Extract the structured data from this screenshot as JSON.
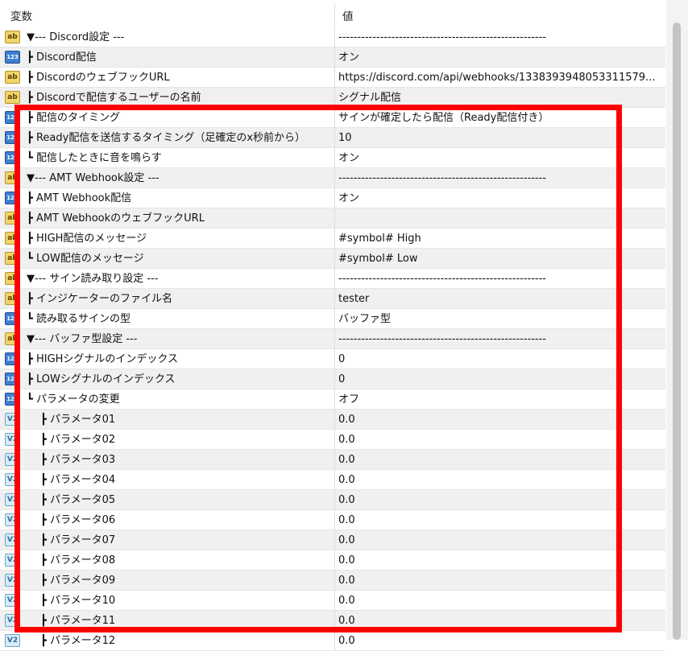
{
  "header": {
    "col_name": "変数",
    "col_value": "値"
  },
  "rows": [
    {
      "name": "▼--- Discord設定 ---",
      "value": "-------------------------------------------------------",
      "icon": "ab",
      "indent": 0
    },
    {
      "name": "┣ Discord配信",
      "value": "オン",
      "icon": "123",
      "indent": 0
    },
    {
      "name": "┣ DiscordのウェブフックURL",
      "value": "https://discord.com/api/webhooks/1338393948053311579...",
      "icon": "ab",
      "indent": 0
    },
    {
      "name": "┣ Discordで配信するユーザーの名前",
      "value": "シグナル配信",
      "icon": "ab",
      "indent": 0
    },
    {
      "name": "┣ 配信のタイミング",
      "value": "サインが確定したら配信（Ready配信付き）",
      "icon": "123",
      "indent": 0
    },
    {
      "name": "┣ Ready配信を送信するタイミング（足確定のx秒前から）",
      "value": "10",
      "icon": "123",
      "indent": 0
    },
    {
      "name": "┗ 配信したときに音を鳴らす",
      "value": "オン",
      "icon": "123",
      "indent": 0
    },
    {
      "name": "▼--- AMT Webhook設定 ---",
      "value": "-------------------------------------------------------",
      "icon": "ab",
      "indent": 0
    },
    {
      "name": "┣ AMT Webhook配信",
      "value": "オン",
      "icon": "123",
      "indent": 0
    },
    {
      "name": "┣ AMT WebhookのウェブフックURL",
      "value": "",
      "icon": "ab",
      "indent": 0
    },
    {
      "name": "┣ HIGH配信のメッセージ",
      "value": "#symbol# High",
      "icon": "ab",
      "indent": 0
    },
    {
      "name": "┗ LOW配信のメッセージ",
      "value": "#symbol# Low",
      "icon": "ab",
      "indent": 0
    },
    {
      "name": "▼--- サイン読み取り設定 ---",
      "value": "-------------------------------------------------------",
      "icon": "ab",
      "indent": 0
    },
    {
      "name": "┣ インジケーターのファイル名",
      "value": "tester",
      "icon": "ab",
      "indent": 0
    },
    {
      "name": "┗ 読み取るサインの型",
      "value": "バッファ型",
      "icon": "123",
      "indent": 0
    },
    {
      "name": "▼--- バッファ型設定 ---",
      "value": "-------------------------------------------------------",
      "icon": "ab",
      "indent": 0
    },
    {
      "name": "┣ HIGHシグナルのインデックス",
      "value": "0",
      "icon": "123",
      "indent": 0
    },
    {
      "name": "┣ LOWシグナルのインデックス",
      "value": "0",
      "icon": "123",
      "indent": 0
    },
    {
      "name": "┗ パラメータの変更",
      "value": "オフ",
      "icon": "123",
      "indent": 0
    },
    {
      "name": "┣ パラメータ01",
      "value": "0.0",
      "icon": "v2",
      "indent": 1
    },
    {
      "name": "┣ パラメータ02",
      "value": "0.0",
      "icon": "v2",
      "indent": 1
    },
    {
      "name": "┣ パラメータ03",
      "value": "0.0",
      "icon": "v2",
      "indent": 1
    },
    {
      "name": "┣ パラメータ04",
      "value": "0.0",
      "icon": "v2",
      "indent": 1
    },
    {
      "name": "┣ パラメータ05",
      "value": "0.0",
      "icon": "v2",
      "indent": 1
    },
    {
      "name": "┣ パラメータ06",
      "value": "0.0",
      "icon": "v2",
      "indent": 1
    },
    {
      "name": "┣ パラメータ07",
      "value": "0.0",
      "icon": "v2",
      "indent": 1
    },
    {
      "name": "┣ パラメータ08",
      "value": "0.0",
      "icon": "v2",
      "indent": 1
    },
    {
      "name": "┣ パラメータ09",
      "value": "0.0",
      "icon": "v2",
      "indent": 1
    },
    {
      "name": "┣ パラメータ10",
      "value": "0.0",
      "icon": "v2",
      "indent": 1
    },
    {
      "name": "┣ パラメータ11",
      "value": "0.0",
      "icon": "v2",
      "indent": 1
    },
    {
      "name": "┣ パラメータ12",
      "value": "0.0",
      "icon": "v2",
      "indent": 1
    }
  ],
  "highlight_color": "#ff0000",
  "accent_blue": "#3f7fd0",
  "accent_yellow": "#f3d46c"
}
